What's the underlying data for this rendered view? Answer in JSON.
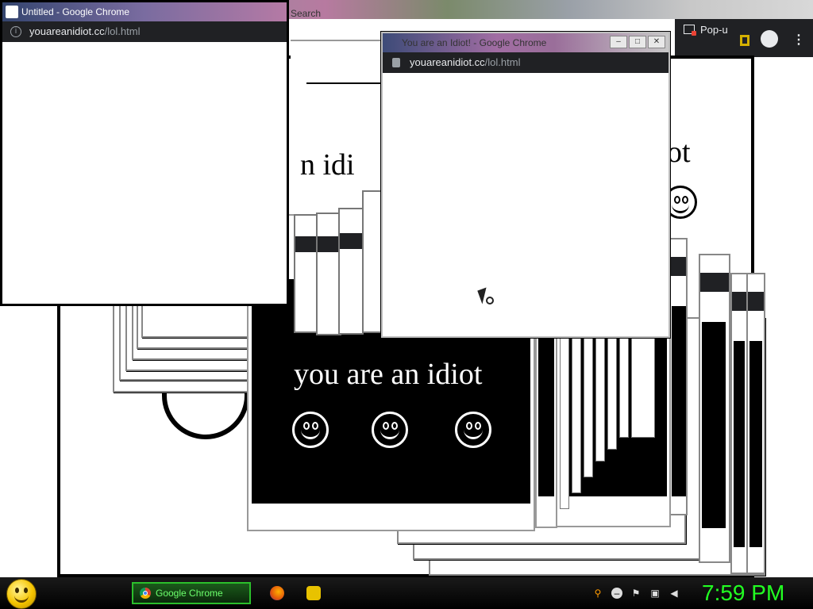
{
  "background_window": {
    "title": "Untitled - Google Chrome",
    "search_label": "Search",
    "idiot_text_partial": "n idi",
    "idiot_text_right": "ot"
  },
  "main_idiot_window": {
    "message": "you are an idiot",
    "smiley_count": 3
  },
  "left_popup": {
    "url_host": "youareanidiot.cc",
    "url_path": "/lol.html"
  },
  "right_popup": {
    "title": "You are an Idiot! - Google Chrome",
    "url_host": "youareanidiot.cc",
    "url_path": "/lol.html",
    "minimize_symbol": "–",
    "maximize_symbol": "□",
    "close_symbol": "✕"
  },
  "chrome_toolbar": {
    "popup_tab_label": "Pop-u",
    "menu_symbol": "⋮"
  },
  "taskbar": {
    "chrome_button_label": "Google Chrome",
    "clock": "7:59 PM"
  },
  "colors": {
    "clock_green": "#22ff22",
    "chrome_dark": "#202124"
  }
}
